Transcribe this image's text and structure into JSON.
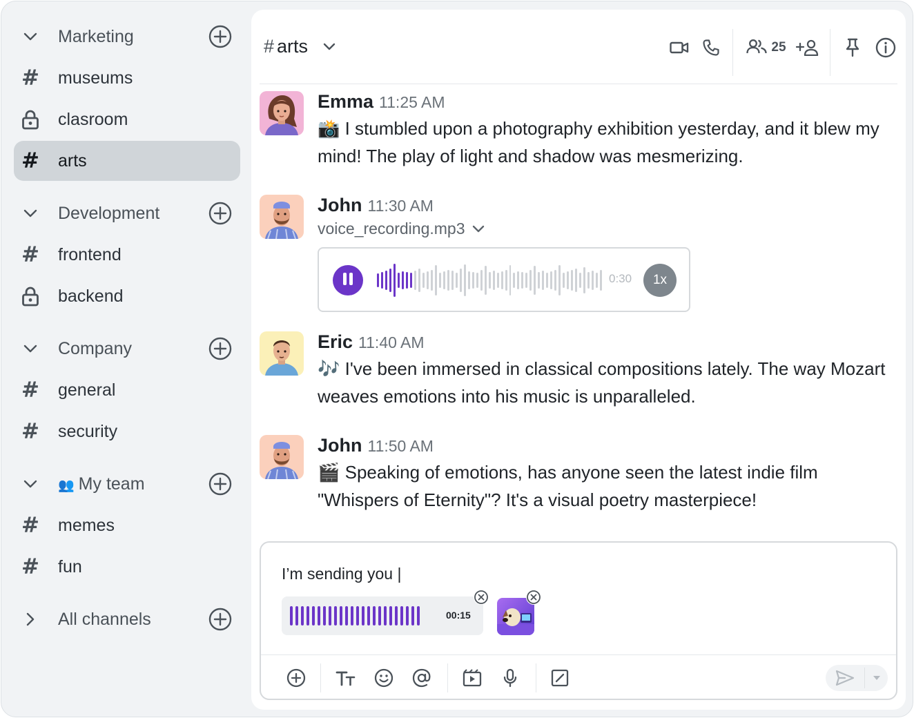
{
  "sidebar": {
    "groups": [
      {
        "label": "Marketing",
        "channels": [
          {
            "label": "museums",
            "icon": "hash-icon"
          },
          {
            "label": "clasroom",
            "icon": "lock-icon"
          },
          {
            "label": "arts",
            "icon": "hash-icon",
            "active": true
          }
        ]
      },
      {
        "label": "Development",
        "channels": [
          {
            "label": "frontend",
            "icon": "hash-icon"
          },
          {
            "label": "backend",
            "icon": "lock-icon"
          }
        ]
      },
      {
        "label": "Company",
        "channels": [
          {
            "label": "general",
            "icon": "hash-icon"
          },
          {
            "label": "security",
            "icon": "hash-icon"
          }
        ]
      },
      {
        "label": "My team",
        "emoji": "👥",
        "channels": [
          {
            "label": "memes",
            "icon": "hash-icon"
          },
          {
            "label": "fun",
            "icon": "hash-icon"
          }
        ]
      }
    ],
    "all_channels": "All channels",
    "hash_symbol": "#"
  },
  "header": {
    "hash": "#",
    "channel_name": "arts",
    "member_count": "25"
  },
  "messages": [
    {
      "author": "Emma",
      "time": "11:25 AM",
      "emoji": "📸",
      "text": "I stumbled upon a photography exhibition yesterday, and it blew my mind! The play of light and shadow was mesmerizing."
    },
    {
      "author": "John",
      "time": "11:30 AM",
      "file_name": "voice_recording.mp3",
      "voice_duration": "0:30",
      "speed": "1x",
      "progress": 0.17
    },
    {
      "author": "Eric",
      "time": "11:40 AM",
      "emoji": "🎶",
      "text": "I've been immersed in classical compositions lately. The way Mozart weaves emotions into his music is unparalleled."
    },
    {
      "author": "John",
      "time": "11:50 AM",
      "emoji": "🎬",
      "text": "Speaking of emotions, has anyone seen the latest indie film \"Whispers of Eternity\"? It's a visual poetry masterpiece!"
    }
  ],
  "composer": {
    "draft": "I’m sending you |",
    "voice_attachment_duration": "00:15"
  },
  "colors": {
    "accent": "#6b35c8",
    "sidebar_bg": "#f1f3f5",
    "active_item": "#d0d5d9"
  }
}
